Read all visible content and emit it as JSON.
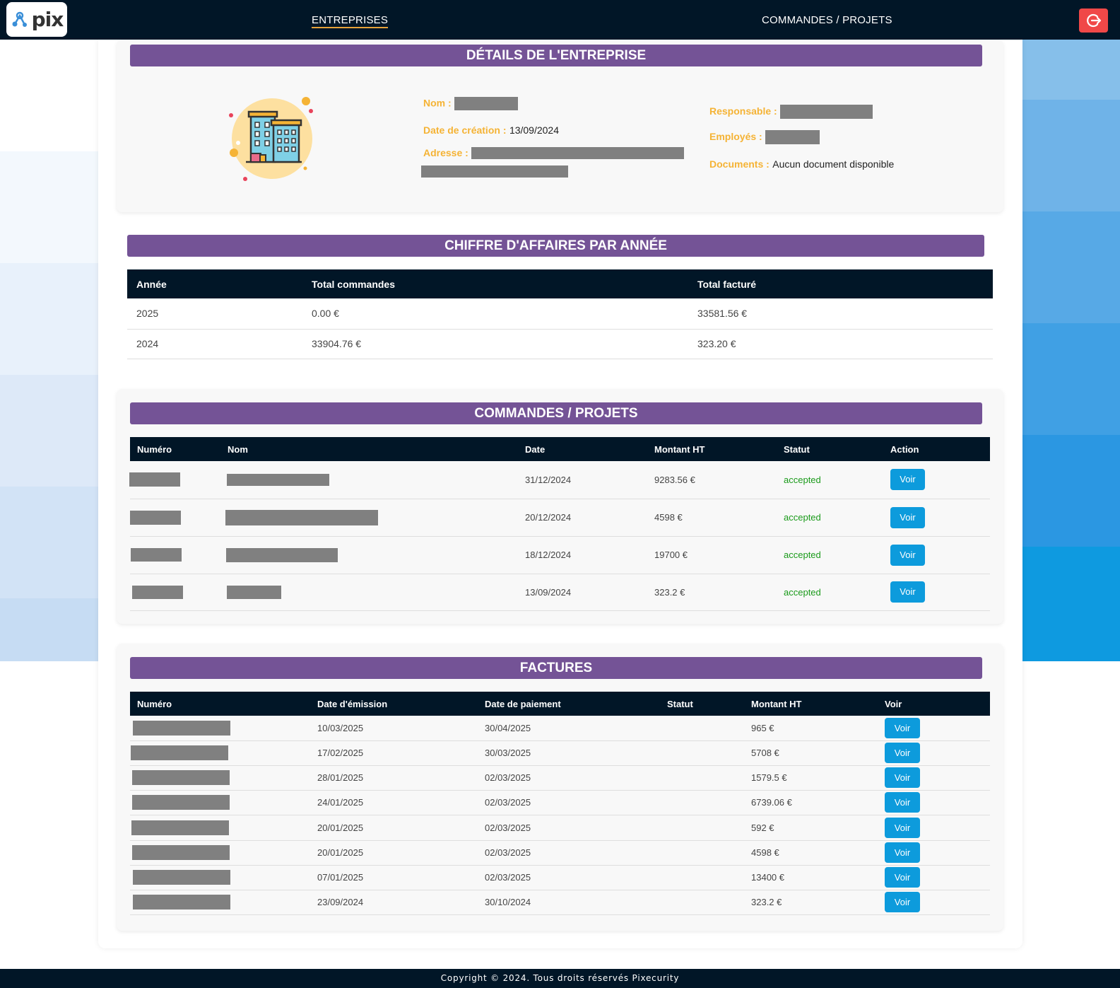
{
  "nav": {
    "logo_text": "pix",
    "links": [
      "ENTREPRISES",
      "COMMANDES / PROJETS"
    ],
    "logout_icon": "logout-icon"
  },
  "company": {
    "section_title": "DÉTAILS DE L'ENTREPRISE",
    "nom_label": "Nom :",
    "creation_label": "Date de création :",
    "creation_value": "13/09/2024",
    "adresse_label": "Adresse :",
    "responsable_label": "Responsable :",
    "employes_label": "Employés :",
    "documents_label": "Documents :",
    "documents_value": "Aucun document disponible",
    "illustration_icon": "building-icon"
  },
  "revenue": {
    "section_title": "CHIFFRE D'AFFAIRES PAR ANNÉE",
    "headers": [
      "Année",
      "Total commandes",
      "Total facturé"
    ],
    "rows": [
      [
        "2025",
        "0.00 €",
        "33581.56 €"
      ],
      [
        "2024",
        "33904.76 €",
        "323.20 €"
      ]
    ]
  },
  "orders": {
    "section_title": "COMMANDES / PROJETS",
    "headers": [
      "Numéro",
      "Nom",
      "Date",
      "Montant HT",
      "Statut",
      "Action"
    ],
    "rows": [
      {
        "date": "31/12/2024",
        "amount": "9283.56 €",
        "status": "accepted",
        "action": "Voir"
      },
      {
        "date": "20/12/2024",
        "amount": "4598 €",
        "status": "accepted",
        "action": "Voir"
      },
      {
        "date": "18/12/2024",
        "amount": "19700 €",
        "status": "accepted",
        "action": "Voir"
      },
      {
        "date": "13/09/2024",
        "amount": "323.2 €",
        "status": "accepted",
        "action": "Voir"
      }
    ]
  },
  "invoices": {
    "section_title": "FACTURES",
    "headers": [
      "Numéro",
      "Date d'émission",
      "Date de paiement",
      "Statut",
      "Montant HT",
      "Voir"
    ],
    "rows": [
      {
        "issued": "10/03/2025",
        "paid": "30/04/2025",
        "amount": "965 €",
        "action": "Voir"
      },
      {
        "issued": "17/02/2025",
        "paid": "30/03/2025",
        "amount": "5708 €",
        "action": "Voir"
      },
      {
        "issued": "28/01/2025",
        "paid": "02/03/2025",
        "amount": "1579.5 €",
        "action": "Voir"
      },
      {
        "issued": "24/01/2025",
        "paid": "02/03/2025",
        "amount": "6739.06 €",
        "action": "Voir"
      },
      {
        "issued": "20/01/2025",
        "paid": "02/03/2025",
        "amount": "592 €",
        "action": "Voir"
      },
      {
        "issued": "20/01/2025",
        "paid": "02/03/2025",
        "amount": "4598 €",
        "action": "Voir"
      },
      {
        "issued": "07/01/2025",
        "paid": "02/03/2025",
        "amount": "13400 €",
        "action": "Voir"
      },
      {
        "issued": "23/09/2024",
        "paid": "30/10/2024",
        "amount": "323.2 €",
        "action": "Voir"
      }
    ]
  },
  "footer": {
    "text": "Copyright © 2024. Tous droits réservés Pixecurity"
  },
  "colors": {
    "navbar": "#011627",
    "section_title_bg": "#745396",
    "label": "#f5b335",
    "voir_button": "#0d9bdc",
    "status_accepted": "#1a9a1a",
    "logout": "#f04848"
  }
}
